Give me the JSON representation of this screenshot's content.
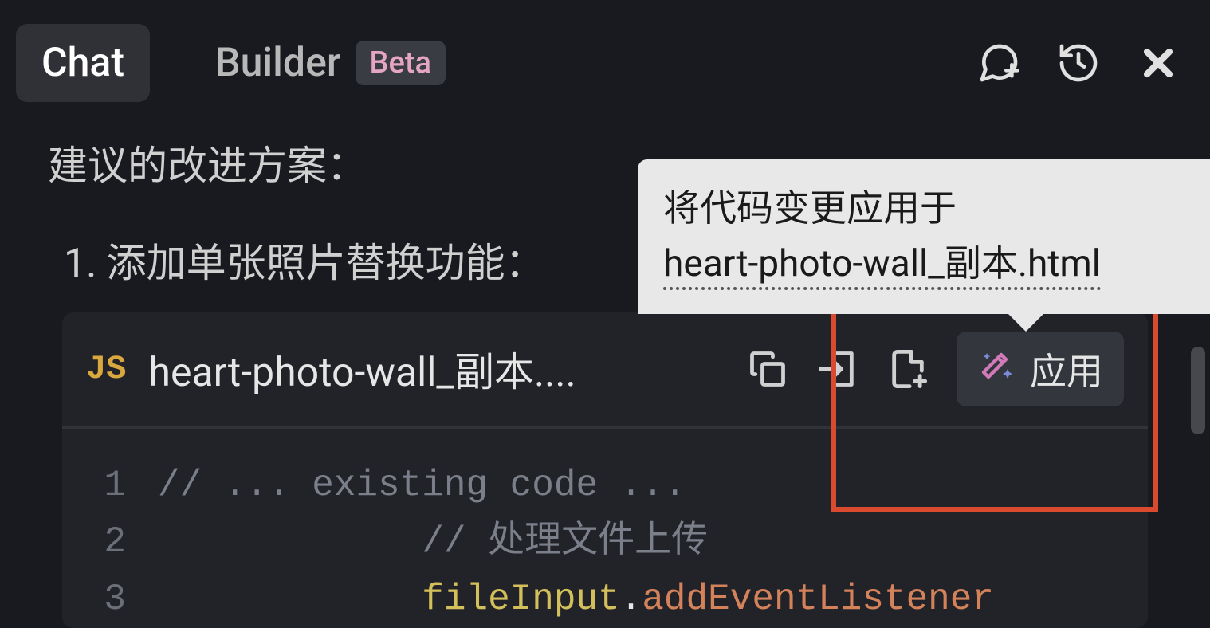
{
  "header": {
    "tabs": {
      "chat": "Chat",
      "builder": "Builder",
      "builder_badge": "Beta"
    }
  },
  "content": {
    "heading": "建议的改进方案：",
    "list": {
      "item1": "1. 添加单张照片替换功能："
    }
  },
  "tooltip": {
    "line1": "将代码变更应用于",
    "line2": "heart-photo-wall_副本.html"
  },
  "code_block": {
    "file_icon": "JS",
    "file_name": "heart-photo-wall_副本....",
    "apply_label": "应用",
    "lines": [
      {
        "num": "1",
        "tokens": [
          {
            "text": "// ... existing code ...",
            "class": "tok-comment"
          }
        ]
      },
      {
        "num": "2",
        "tokens": [
          {
            "text": "            ",
            "class": ""
          },
          {
            "text": "// 处理文件上传",
            "class": "tok-comment"
          }
        ]
      },
      {
        "num": "3",
        "tokens": [
          {
            "text": "            ",
            "class": ""
          },
          {
            "text": "fileInput",
            "class": "tok-var"
          },
          {
            "text": ".",
            "class": ""
          },
          {
            "text": "addEventListener",
            "class": "tok-func"
          }
        ]
      }
    ]
  }
}
